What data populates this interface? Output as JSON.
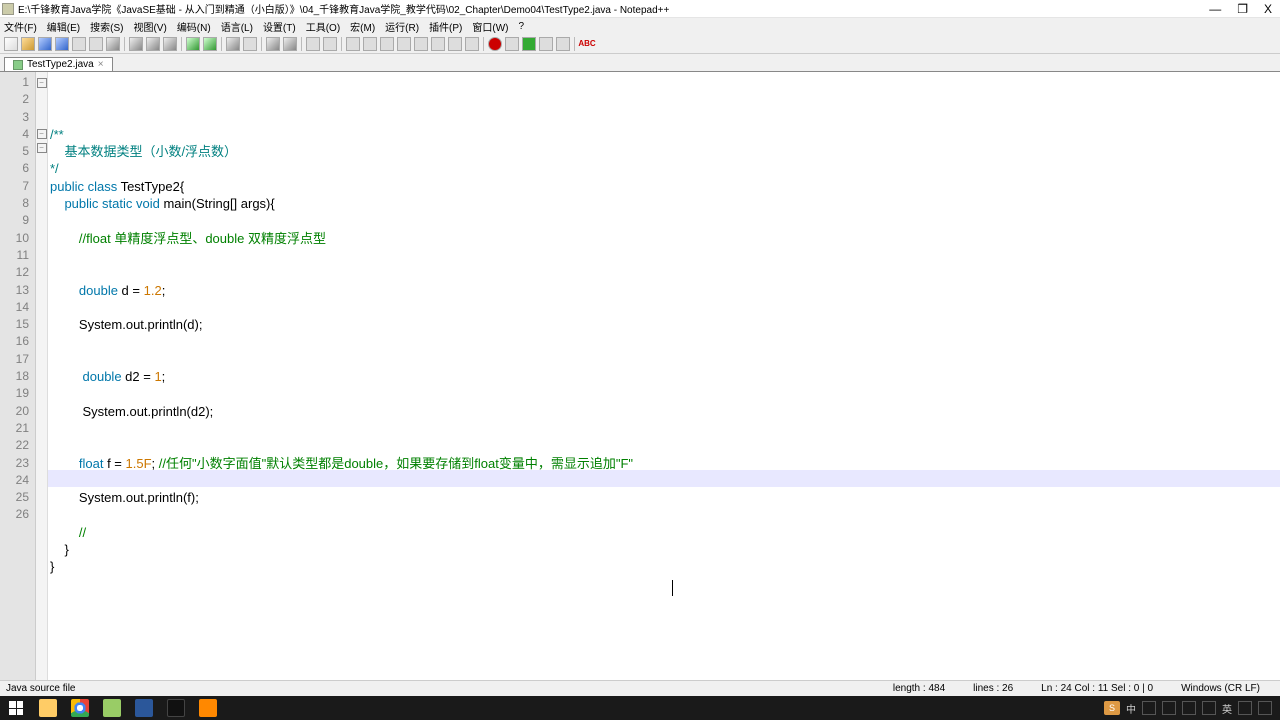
{
  "title": "E:\\千锋教育Java学院《JavaSE基础 - 从入门到精通（小白版）》\\04_千锋教育Java学院_教学代码\\02_Chapter\\Demo04\\TestType2.java - Notepad++",
  "win_controls": {
    "min": "—",
    "max": "❐",
    "close": "X"
  },
  "menus": [
    "文件(F)",
    "编辑(E)",
    "搜索(S)",
    "视图(V)",
    "编码(N)",
    "语言(L)",
    "设置(T)",
    "工具(O)",
    "宏(M)",
    "运行(R)",
    "插件(P)",
    "窗口(W)",
    "?"
  ],
  "tab_label": "TestType2.java",
  "code": {
    "l1": "/**",
    "l2": "    基本数据类型（小数/浮点数）",
    "l3": "*/",
    "l4a": "public",
    "l4b": " class",
    "l4c": " TestType2{",
    "l5a": "    public",
    "l5b": " static",
    "l5c": " void",
    "l5d": " main(String[] args){",
    "l6": "",
    "l7a": "        ",
    "l7b": "//float 单精度浮点型、double 双精度浮点型",
    "l8": "",
    "l9": "",
    "l10a": "        double",
    "l10b": " d = ",
    "l10c": "1.2",
    "l10d": ";",
    "l11": "",
    "l12": "        System.out.println(d);",
    "l13": "",
    "l14": "",
    "l15a": "         double",
    "l15b": " d2 = ",
    "l15c": "1",
    "l15d": ";",
    "l16": "",
    "l17": "         System.out.println(d2);",
    "l18": "",
    "l19": "",
    "l20a": "        float",
    "l20b": " f = ",
    "l20c": "1.5F",
    "l20d": "; ",
    "l20e": "//任何\"小数字面值\"默认类型都是double，如果要存储到float变量中，需显示追加\"F\"",
    "l21": "",
    "l22": "        System.out.println(f);",
    "l23": "",
    "l24a": "        ",
    "l24b": "//",
    "l25": "    }",
    "l26": "}"
  },
  "status": {
    "type": "Java source file",
    "length": "length : 484",
    "lines": "lines : 26",
    "pos": "Ln : 24    Col : 11    Sel : 0 | 0",
    "os": "Windows (CR LF)"
  },
  "tray": {
    "ime_label": "S",
    "lang": "中",
    "input": "英"
  }
}
